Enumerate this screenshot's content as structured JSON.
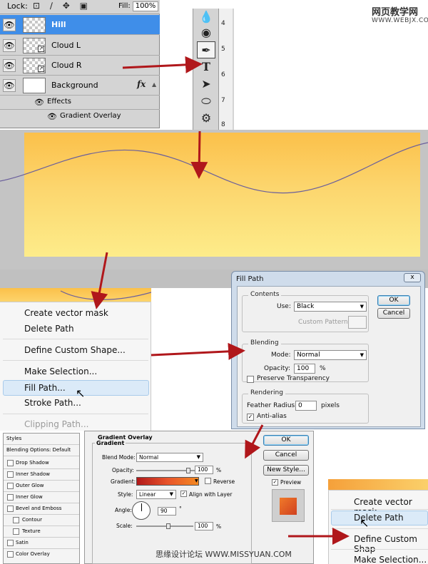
{
  "watermark": {
    "title": "网页教学网",
    "url": "WWW.WEBJX.COM",
    "bottom": "思缘设计论坛 WWW.MISSYUAN.COM"
  },
  "layers": {
    "lock_label": "Lock:",
    "lock_icons": "⊡ ∕ ✥ ▣",
    "fill_label": "Fill:",
    "fill_value": "100%",
    "rows": [
      {
        "name": "Hill",
        "selected": true
      },
      {
        "name": "Cloud L"
      },
      {
        "name": "Cloud R"
      },
      {
        "name": "Background"
      }
    ],
    "fx": "fx",
    "effects_label": "Effects",
    "gradient_overlay_label": "Gradient Overlay"
  },
  "tools": {
    "ruler_numbers": [
      "4",
      "5",
      "6",
      "7",
      "8"
    ]
  },
  "context_menu_1": {
    "items": [
      "Create vector mask",
      "Delete Path",
      "Define Custom Shape...",
      "Make Selection...",
      "Fill Path...",
      "Stroke Path...",
      "Clipping Path..."
    ]
  },
  "fill_path_dialog": {
    "title": "Fill Path",
    "close": "x",
    "contents_title": "Contents",
    "use_label": "Use:",
    "use_value": "Black",
    "custom_pattern_label": "Custom Pattern:",
    "blending_title": "Blending",
    "mode_label": "Mode:",
    "mode_value": "Normal",
    "opacity_label": "Opacity:",
    "opacity_value": "100",
    "opacity_unit": "%",
    "preserve_transparency": "Preserve Transparency",
    "rendering_title": "Rendering",
    "feather_label": "Feather Radius:",
    "feather_value": "0",
    "feather_unit": "pixels",
    "anti_alias": "Anti-alias",
    "ok": "OK",
    "cancel": "Cancel"
  },
  "layer_style": {
    "styles_header": "Styles",
    "blending_options": "Blending Options: Default",
    "style_items": [
      "Drop Shadow",
      "Inner Shadow",
      "Outer Glow",
      "Inner Glow",
      "Bevel and Emboss",
      "Contour",
      "Texture",
      "Satin",
      "Color Overlay"
    ],
    "go_title": "Gradient Overlay",
    "gradient_group": "Gradient",
    "blend_mode_label": "Blend Mode:",
    "blend_mode_value": "Normal",
    "opacity_label": "Opacity:",
    "opacity_value": "100",
    "percent": "%",
    "gradient_label": "Gradient:",
    "reverse": "Reverse",
    "style_label": "Style:",
    "style_value": "Linear",
    "align_with_layer": "Align with Layer",
    "angle_label": "Angle:",
    "angle_value": "90",
    "angle_unit": "°",
    "scale_label": "Scale:",
    "scale_value": "100",
    "ok": "OK",
    "cancel": "Cancel",
    "new_style": "New Style...",
    "preview": "Preview"
  },
  "context_menu_2": {
    "items": [
      "Create vector mask",
      "Delete Path",
      "Define Custom Shap",
      "Make Selection..."
    ]
  },
  "colors": {
    "selection_blue": "#3f8ee9",
    "canvas_top": "#fbc04a",
    "canvas_bottom": "#fdec8a",
    "arrow_red": "#b0171b",
    "menu_highlight": "#dbeaf8"
  }
}
